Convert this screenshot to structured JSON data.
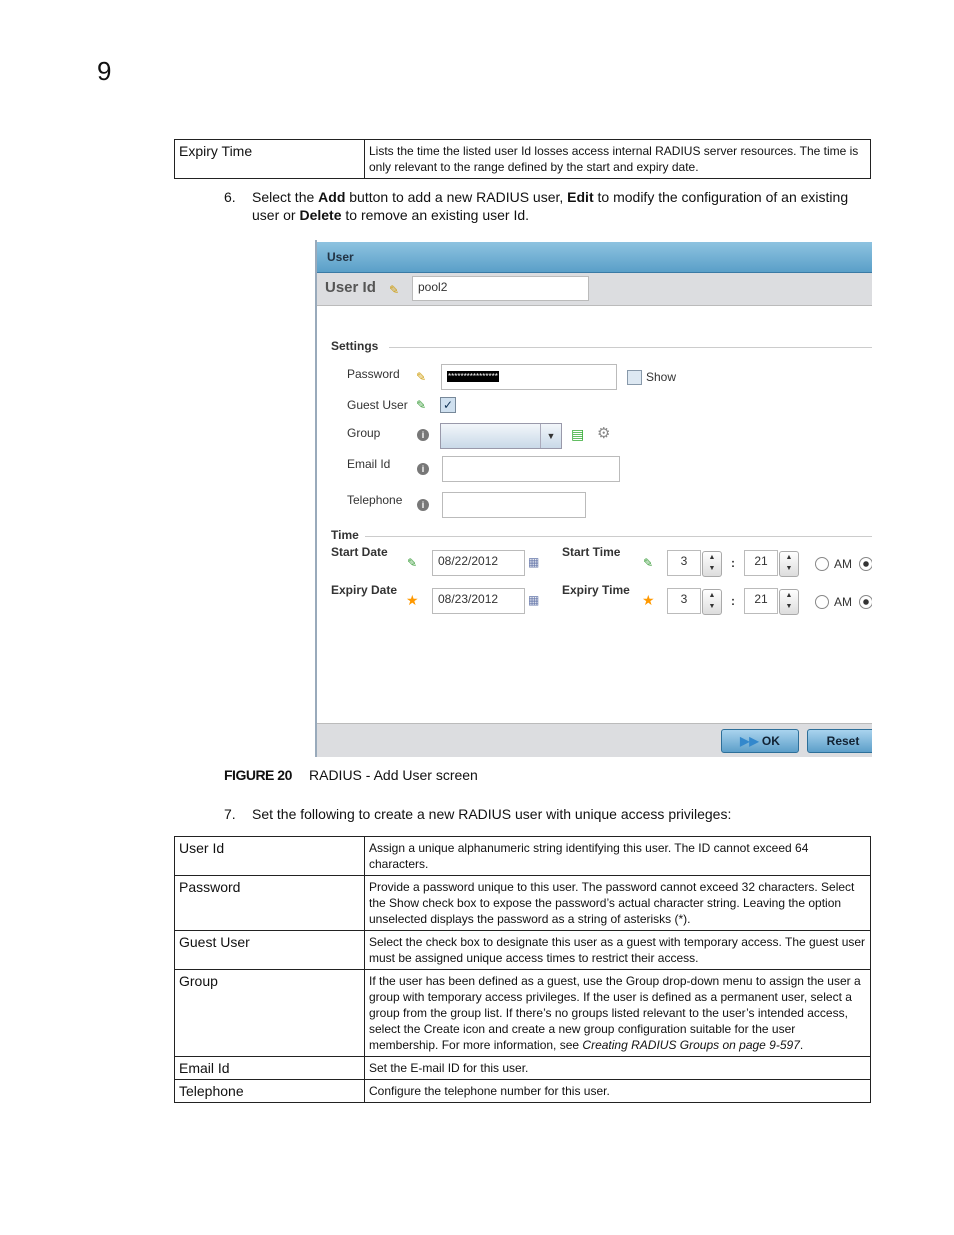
{
  "chapter": "9",
  "table1": [
    {
      "term": "Expiry Time",
      "desc": "Lists the time the listed user Id losses access internal RADIUS server resources. The time is only relevant to the range defined by the start and expiry date."
    }
  ],
  "step6": {
    "num": "6.",
    "pre": "Select the ",
    "add": "Add",
    "mid1": " button to add a new RADIUS user, ",
    "edit": "Edit",
    "mid2": " to modify the configuration of an existing user or ",
    "del": "Delete",
    "post": " to remove an existing user Id."
  },
  "screen": {
    "header": "User",
    "user_id_label": "User Id",
    "user_id_value": "pool2",
    "settings_label": "Settings",
    "password_label": "Password",
    "password_value": "****************",
    "show_label": "Show",
    "show_checked": false,
    "guest_label": "Guest User",
    "guest_checked": true,
    "group_label": "Group",
    "group_value": "",
    "email_label": "Email Id",
    "email_value": "",
    "telephone_label": "Telephone",
    "telephone_value": "",
    "time_label": "Time",
    "start_date_label": "Start Date",
    "start_date": "08/22/2012",
    "expiry_date_label": "Expiry Date",
    "expiry_date": "08/23/2012",
    "start_time_label": "Start Time",
    "start_hour": "3",
    "start_min": "21",
    "expiry_time_label": "Expiry Time",
    "expiry_hour": "3",
    "expiry_min": "21",
    "colon": ":",
    "am": "AM",
    "ok": "OK",
    "reset": "Reset"
  },
  "figure": {
    "label": "FIGURE 20",
    "caption": "RADIUS - Add User screen"
  },
  "step7": {
    "num": "7.",
    "text": "Set the following to create a new RADIUS user with unique access privileges:"
  },
  "table2": [
    {
      "term": "User Id",
      "desc": "Assign a unique alphanumeric string identifying this user. The ID cannot exceed 64 characters."
    },
    {
      "term": "Password",
      "desc": "Provide a password unique to this user. The password cannot exceed 32 characters. Select the Show check box to expose the password’s actual character string. Leaving the option unselected displays the password as a string of asterisks (*)."
    },
    {
      "term": "Guest User",
      "desc": "Select the check box to designate this user as a guest with temporary access. The guest user must be assigned unique access times to restrict their access."
    },
    {
      "term": "Group",
      "desc": "If the user has been defined as a guest, use the Group drop-down menu to assign the user a group with temporary access privileges. If the user is defined as a permanent user, select a group from the group list. If there’s no groups listed relevant to the user’s intended access, select the Create icon and create a new group configuration suitable for the user membership. For more information, see ",
      "link": "Creating RADIUS Groups on page 9-597",
      "end": "."
    },
    {
      "term": "Email Id",
      "desc": "Set the E-mail ID for this user."
    },
    {
      "term": "Telephone",
      "desc": "Configure the telephone number for this user."
    }
  ]
}
